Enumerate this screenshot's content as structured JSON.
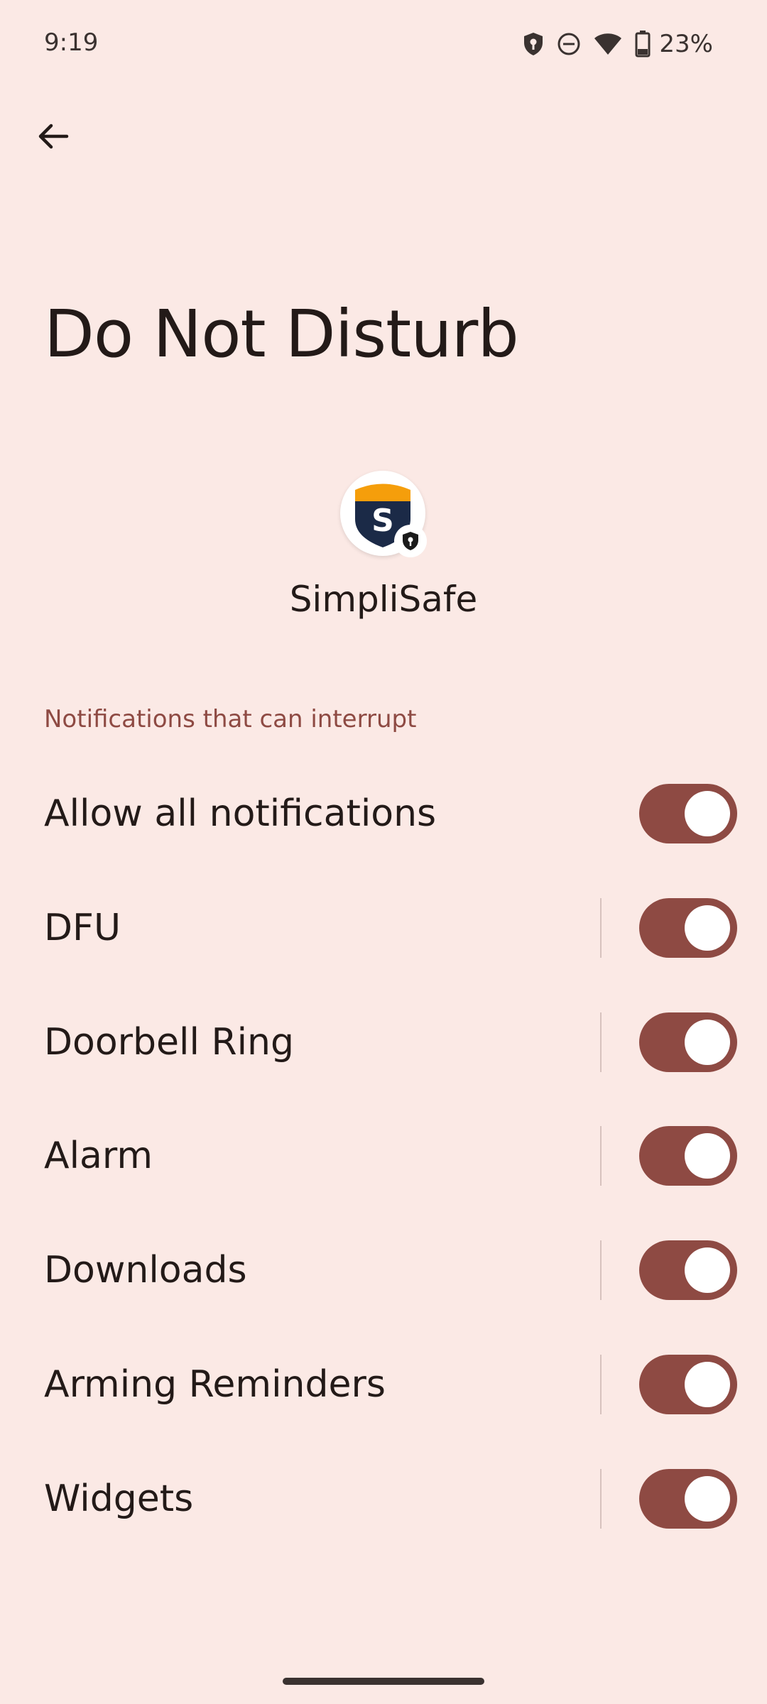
{
  "status_bar": {
    "time": "9:19",
    "battery_percent": "23%",
    "icons": [
      "shield-key-icon",
      "do-not-disturb-icon",
      "wifi-icon",
      "battery-icon"
    ]
  },
  "header": {
    "back_icon": "arrow-back-icon",
    "title": "Do Not Disturb"
  },
  "app": {
    "name": "SimpliSafe",
    "icon": "simplisafe-shield-icon",
    "icon_letter": "S",
    "colors": {
      "shield_top": "#f59e0b",
      "shield_body": "#1b2a47"
    }
  },
  "section": {
    "header": "Notifications that can interrupt"
  },
  "rows": [
    {
      "label": "Allow all notifications",
      "enabled": true,
      "has_divider": false
    },
    {
      "label": "DFU",
      "enabled": true,
      "has_divider": true
    },
    {
      "label": "Doorbell Ring",
      "enabled": true,
      "has_divider": true
    },
    {
      "label": "Alarm",
      "enabled": true,
      "has_divider": true
    },
    {
      "label": "Downloads",
      "enabled": true,
      "has_divider": true
    },
    {
      "label": "Arming Reminders",
      "enabled": true,
      "has_divider": true
    },
    {
      "label": "Widgets",
      "enabled": true,
      "has_divider": true
    }
  ],
  "theme": {
    "background": "#fbe9e5",
    "accent": "#8e4a43",
    "text": "#231a18"
  }
}
